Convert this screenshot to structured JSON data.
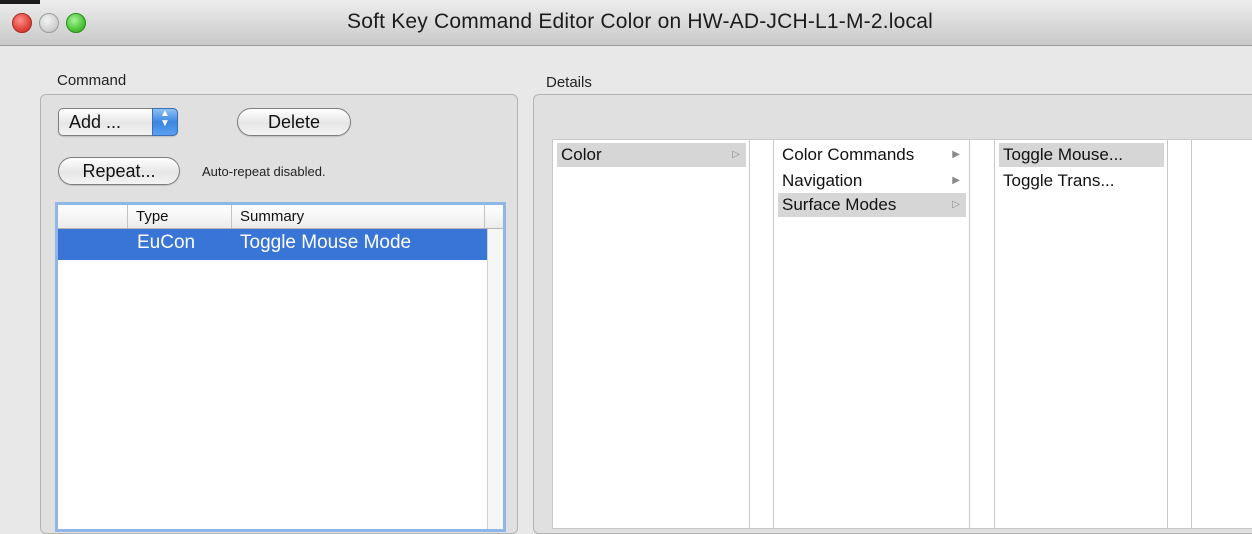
{
  "window": {
    "title": "Soft Key Command Editor Color on  HW-AD-JCH-L1-M-2.local"
  },
  "command": {
    "section_label": "Command",
    "add_label": "Add ...",
    "delete_label": "Delete",
    "repeat_label": "Repeat...",
    "repeat_status": "Auto-repeat disabled.",
    "table": {
      "columns": [
        "",
        "Type",
        "Summary"
      ],
      "rows": [
        {
          "type": "EuCon",
          "summary": "Toggle Mouse Mode"
        }
      ]
    }
  },
  "details": {
    "section_label": "Details",
    "column1": {
      "items": [
        {
          "label": "Color",
          "selected": true
        }
      ]
    },
    "column2": {
      "items": [
        {
          "label": "Color Commands"
        },
        {
          "label": "Navigation"
        },
        {
          "label": "Surface Modes",
          "selected": true
        }
      ]
    },
    "column3": {
      "items": [
        {
          "label": "Toggle Mouse...",
          "selected": true
        },
        {
          "label": "Toggle Trans..."
        }
      ]
    }
  },
  "colors": {
    "selection": "#3875d7",
    "close": "#e0443a",
    "maximize": "#4cc538"
  }
}
